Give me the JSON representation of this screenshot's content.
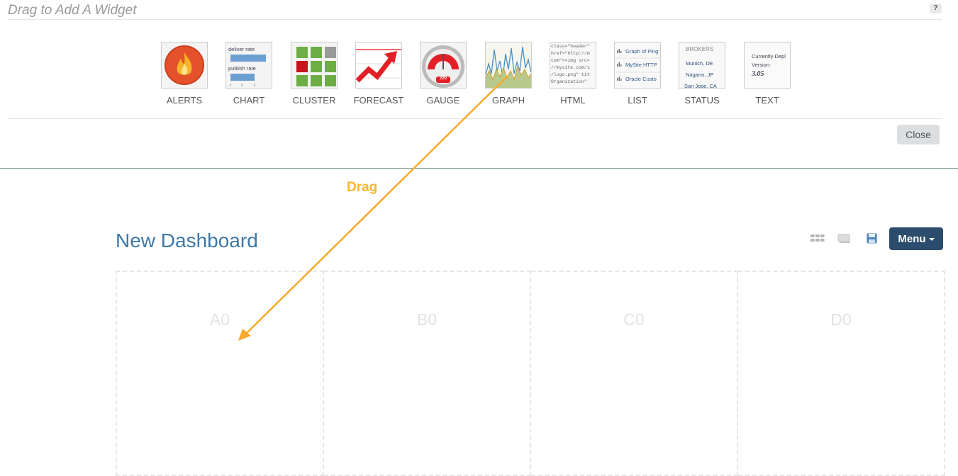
{
  "panel": {
    "title": "Drag to Add A Widget",
    "help": "?",
    "close_label": "Close"
  },
  "widgets": [
    {
      "label": "ALERTS"
    },
    {
      "label": "CHART",
      "thumb_lines": [
        "deliver rate",
        "publish rate"
      ]
    },
    {
      "label": "CLUSTER"
    },
    {
      "label": "FORECAST"
    },
    {
      "label": "GAUGE",
      "thumb_value": "220"
    },
    {
      "label": "GRAPH"
    },
    {
      "label": "HTML",
      "thumb_lines": [
        "class=\"header\"",
        "href=\"http://m",
        "com\"><img src=",
        "//mysite.com/i",
        "/logo.png\" tit",
        "Organization\""
      ]
    },
    {
      "label": "LIST",
      "thumb_lines": [
        "Graph of Ping",
        "MySite HTTP",
        "Oracle Custo"
      ]
    },
    {
      "label": "STATUS",
      "thumb_lines": [
        "BROKERS",
        "Munich, DE",
        "Nagano, JP",
        "San Jose, CA"
      ]
    },
    {
      "label": "TEXT",
      "thumb_lines": [
        "Currently Depl",
        "Version:",
        "3.05"
      ]
    }
  ],
  "annotation": {
    "drag_label": "Drag",
    "arrow_color": "#f7a92b"
  },
  "dashboard": {
    "title": "New Dashboard",
    "menu_label": "Menu",
    "columns": [
      "A0",
      "B0",
      "C0",
      "D0"
    ]
  },
  "colors": {
    "accent": "#3e78a8",
    "menu_button": "#2c4c6e",
    "drag_label": "#f7b62b"
  }
}
